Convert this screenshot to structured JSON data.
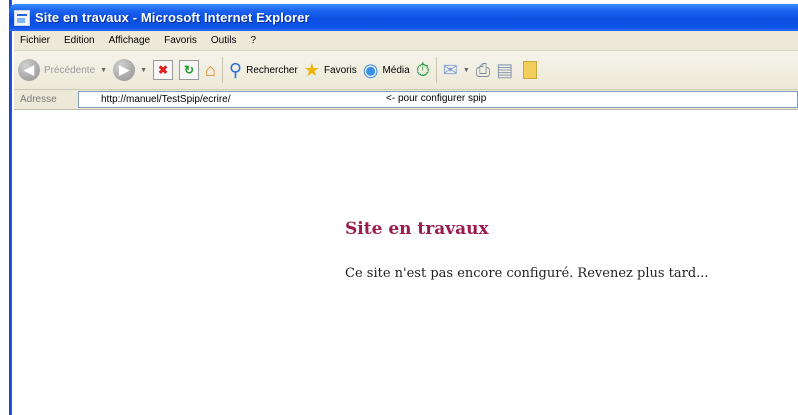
{
  "window": {
    "title": "Site en travaux - Microsoft Internet Explorer"
  },
  "menu": {
    "items": [
      {
        "label": "Fichier"
      },
      {
        "label": "Edition"
      },
      {
        "label": "Affichage"
      },
      {
        "label": "Favoris"
      },
      {
        "label": "Outils"
      },
      {
        "label": "?"
      }
    ]
  },
  "toolbar": {
    "back_label": "Précédente",
    "search_label": "Rechercher",
    "favorites_label": "Favoris",
    "media_label": "Média",
    "icons": [
      "back-icon",
      "forward-icon",
      "stop-icon",
      "refresh-icon",
      "home-icon",
      "search-icon",
      "star-icon",
      "globe-icon",
      "history-icon",
      "mail-icon",
      "print-icon",
      "edit-icon",
      "folder-icon"
    ]
  },
  "address": {
    "label": "Adresse",
    "url": "http://manuel/TestSpip/ecrire/",
    "note": "<- pour configurer spip"
  },
  "page": {
    "heading": "Site en travaux",
    "message": "Ce site n'est pas encore configuré. Revenez plus tard..."
  },
  "colors": {
    "titlebar": "#0a4fe0",
    "heading": "#9b1b4d",
    "chrome": "#ece9d8"
  }
}
